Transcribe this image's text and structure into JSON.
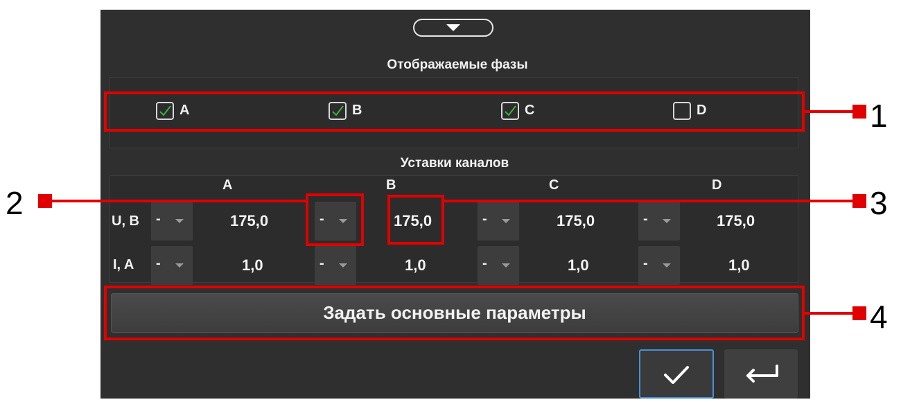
{
  "phases": {
    "title": "Отображаемые фазы",
    "items": [
      {
        "label": "A",
        "checked": true
      },
      {
        "label": "B",
        "checked": true
      },
      {
        "label": "C",
        "checked": true
      },
      {
        "label": "D",
        "checked": false
      }
    ]
  },
  "settings": {
    "title": "Уставки каналов",
    "columns": [
      "A",
      "B",
      "C",
      "D"
    ],
    "rows": [
      {
        "label": "U, B",
        "values": [
          "175,0",
          "175,0",
          "175,0",
          "175,0"
        ]
      },
      {
        "label": "I, A",
        "values": [
          "1,0",
          "1,0",
          "1,0",
          "1,0"
        ]
      }
    ],
    "dropdown_value": "-"
  },
  "main_button": {
    "label": "Задать основные параметры"
  },
  "callouts": [
    "1",
    "2",
    "3",
    "4"
  ],
  "colors": {
    "panel": "#2f2f2f",
    "highlight": "#e00000",
    "check": "#3cb043",
    "ok_border": "#4a8fd6"
  },
  "icons": {
    "collapse": "chevron-down-icon",
    "ok": "checkmark-icon",
    "back": "return-arrow-icon"
  }
}
